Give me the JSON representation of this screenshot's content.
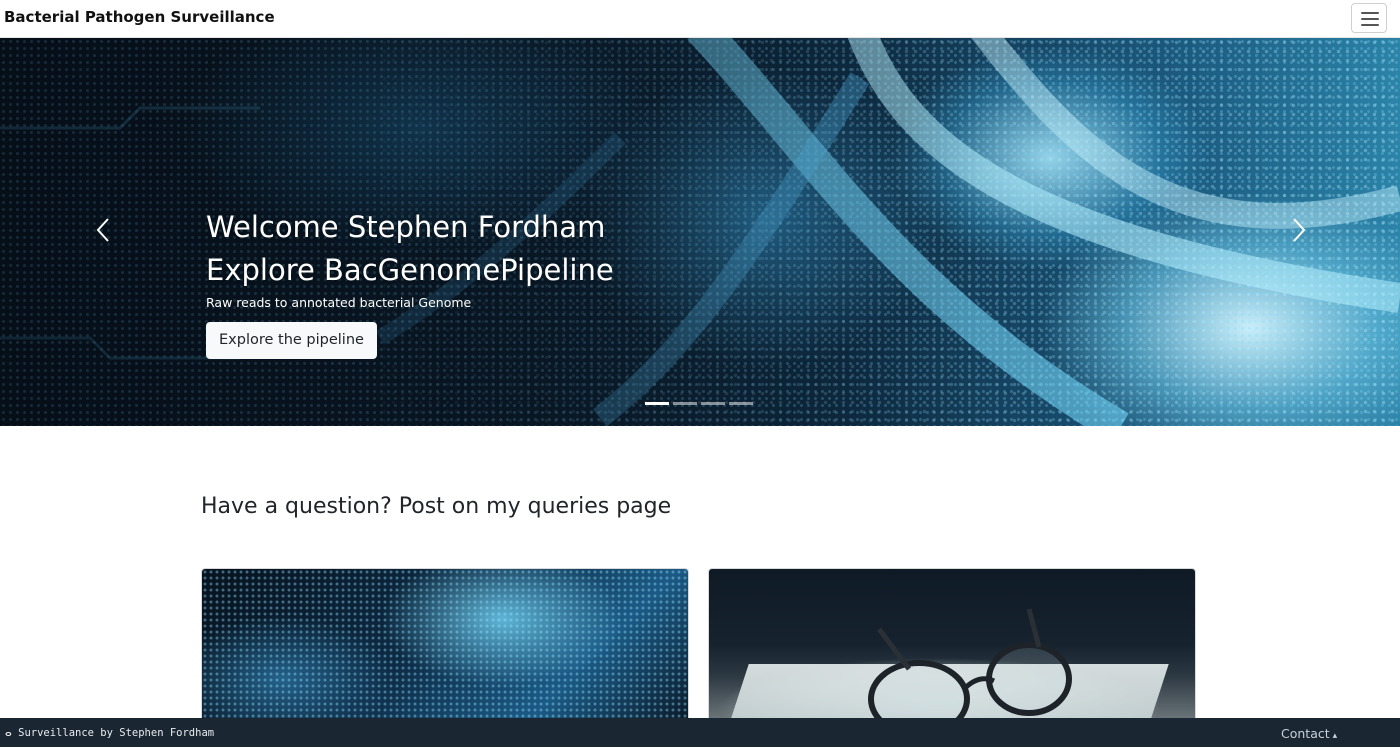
{
  "navbar": {
    "brand": "Bacterial Pathogen Surveillance",
    "toggle_icon": "hamburger-menu-icon"
  },
  "hero": {
    "line1": "Welcome Stephen Fordham",
    "line2": "Explore BacGenomePipeline",
    "subtitle": "Raw reads to annotated bacterial Genome",
    "cta_label": "Explore the pipeline",
    "prev_icon": "chevron-left-icon",
    "next_icon": "chevron-right-icon",
    "slide_count": 4,
    "active_slide": 1
  },
  "section": {
    "title": "Have a question? Post on my queries page"
  },
  "cards": [
    {
      "image": "dna-helix-image"
    },
    {
      "image": "glasses-on-book-image"
    }
  ],
  "footer": {
    "credit": "Surveillance by Stephen Fordham",
    "credit_icon": "pathogen-icon",
    "contact_label": "Contact",
    "contact_caret": "▴"
  },
  "colors": {
    "footer_bg": "#1b2633",
    "navbar_bg": "#ffffff",
    "cta_bg": "#f8f9fa"
  }
}
